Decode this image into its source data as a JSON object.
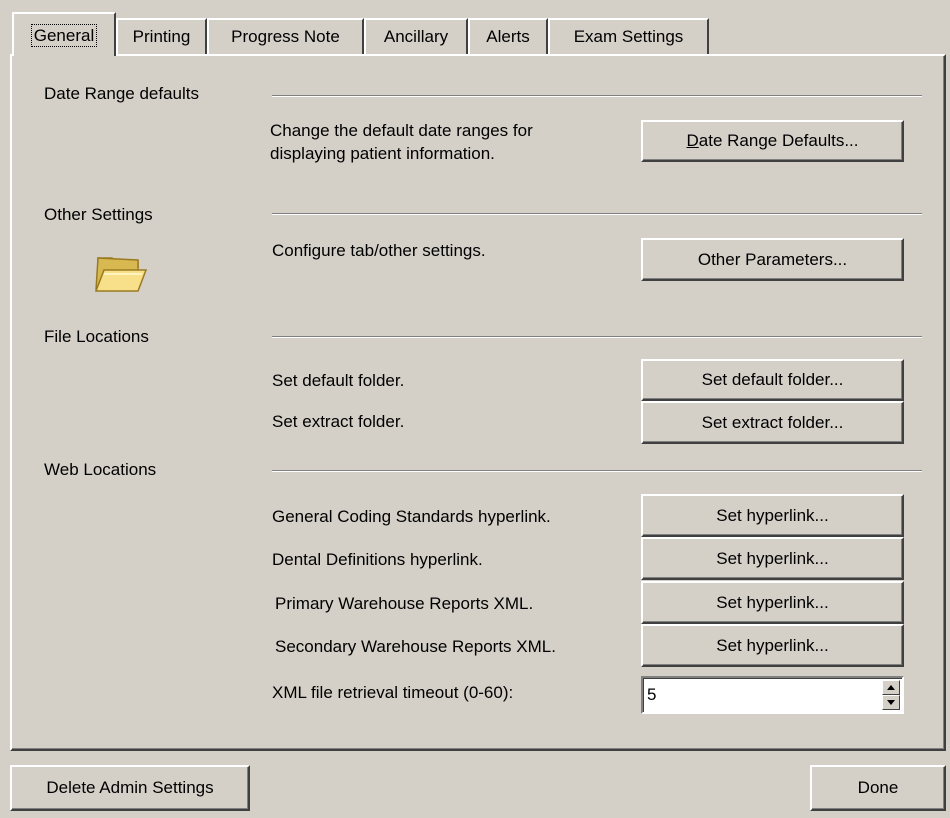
{
  "tabs": [
    {
      "label": "General",
      "active": true
    },
    {
      "label": "Printing",
      "active": false
    },
    {
      "label": "Progress Note",
      "active": false
    },
    {
      "label": "Ancillary",
      "active": false
    },
    {
      "label": "Alerts",
      "active": false
    },
    {
      "label": "Exam Settings",
      "active": false
    }
  ],
  "date_range": {
    "heading": "Date Range defaults",
    "description_line1": "Change the default date ranges for",
    "description_line2": "displaying patient information.",
    "button_mnemonic": "D",
    "button_rest": "ate Range Defaults..."
  },
  "other_settings": {
    "heading": "Other Settings",
    "icon": "folder-icon",
    "description": "Configure tab/other settings.",
    "button": "Other Parameters..."
  },
  "file_locations": {
    "heading": "File Locations",
    "rows": [
      {
        "label": "Set default folder.",
        "button": "Set default folder..."
      },
      {
        "label": "Set extract folder.",
        "button": "Set extract folder..."
      }
    ]
  },
  "web_locations": {
    "heading": "Web Locations",
    "rows": [
      {
        "label": "General Coding Standards hyperlink.",
        "button": "Set hyperlink..."
      },
      {
        "label": "Dental Definitions hyperlink.",
        "button": "Set hyperlink..."
      },
      {
        "label": "Primary Warehouse Reports XML.",
        "button": "Set hyperlink..."
      },
      {
        "label": "Secondary Warehouse Reports XML.",
        "button": "Set hyperlink..."
      }
    ],
    "timeout_label": "XML file retrieval timeout (0-60):",
    "timeout_value": "5"
  },
  "footer": {
    "delete_button": "Delete Admin Settings",
    "done_button": "Done"
  },
  "colors": {
    "face": "#d4d0c8",
    "highlight": "#ffffff",
    "shadow": "#808080",
    "dark_shadow": "#404040",
    "folder_yellow": "#f8e08a"
  }
}
